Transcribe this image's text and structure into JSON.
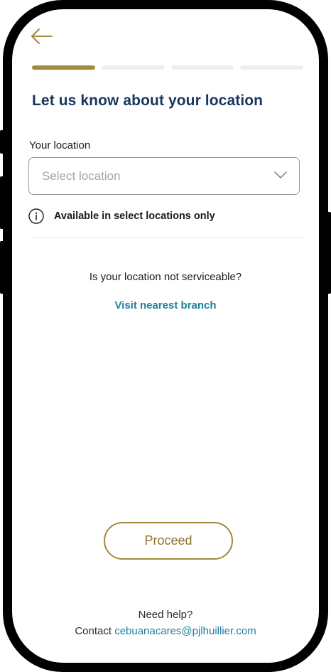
{
  "header": {
    "back_icon": "arrow-left-icon",
    "back_color": "#a48a3e"
  },
  "progress": {
    "total_steps": 4,
    "current_step": 1,
    "active_color": "#a48a3e",
    "inactive_color": "#eeeeee"
  },
  "page": {
    "title": "Let us know about your location"
  },
  "location_field": {
    "label": "Your location",
    "placeholder": "Select location",
    "dropdown_icon": "chevron-down-icon"
  },
  "info": {
    "icon": "info-circle-icon",
    "text": "Available in select locations only"
  },
  "serviceability": {
    "question": "Is your location not serviceable?",
    "link": "Visit nearest branch"
  },
  "actions": {
    "proceed_label": "Proceed"
  },
  "footer": {
    "help_text": "Need help?",
    "contact_prefix": "Contact",
    "contact_email": "cebuanacares@pjlhuillier.com"
  },
  "colors": {
    "title": "#17375e",
    "accent_gold": "#a48a3e",
    "link_blue": "#1f7f9b"
  }
}
